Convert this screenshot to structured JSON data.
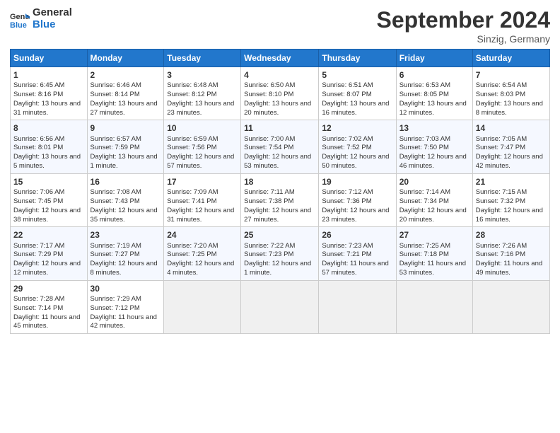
{
  "header": {
    "logo_line1": "General",
    "logo_line2": "Blue",
    "month": "September 2024",
    "location": "Sinzig, Germany"
  },
  "days_of_week": [
    "Sunday",
    "Monday",
    "Tuesday",
    "Wednesday",
    "Thursday",
    "Friday",
    "Saturday"
  ],
  "weeks": [
    [
      {
        "day": "1",
        "sunrise": "6:45 AM",
        "sunset": "8:16 PM",
        "daylight": "13 hours and 31 minutes."
      },
      {
        "day": "2",
        "sunrise": "6:46 AM",
        "sunset": "8:14 PM",
        "daylight": "13 hours and 27 minutes."
      },
      {
        "day": "3",
        "sunrise": "6:48 AM",
        "sunset": "8:12 PM",
        "daylight": "13 hours and 23 minutes."
      },
      {
        "day": "4",
        "sunrise": "6:50 AM",
        "sunset": "8:10 PM",
        "daylight": "13 hours and 20 minutes."
      },
      {
        "day": "5",
        "sunrise": "6:51 AM",
        "sunset": "8:07 PM",
        "daylight": "13 hours and 16 minutes."
      },
      {
        "day": "6",
        "sunrise": "6:53 AM",
        "sunset": "8:05 PM",
        "daylight": "13 hours and 12 minutes."
      },
      {
        "day": "7",
        "sunrise": "6:54 AM",
        "sunset": "8:03 PM",
        "daylight": "13 hours and 8 minutes."
      }
    ],
    [
      {
        "day": "8",
        "sunrise": "6:56 AM",
        "sunset": "8:01 PM",
        "daylight": "13 hours and 5 minutes."
      },
      {
        "day": "9",
        "sunrise": "6:57 AM",
        "sunset": "7:59 PM",
        "daylight": "13 hours and 1 minute."
      },
      {
        "day": "10",
        "sunrise": "6:59 AM",
        "sunset": "7:56 PM",
        "daylight": "12 hours and 57 minutes."
      },
      {
        "day": "11",
        "sunrise": "7:00 AM",
        "sunset": "7:54 PM",
        "daylight": "12 hours and 53 minutes."
      },
      {
        "day": "12",
        "sunrise": "7:02 AM",
        "sunset": "7:52 PM",
        "daylight": "12 hours and 50 minutes."
      },
      {
        "day": "13",
        "sunrise": "7:03 AM",
        "sunset": "7:50 PM",
        "daylight": "12 hours and 46 minutes."
      },
      {
        "day": "14",
        "sunrise": "7:05 AM",
        "sunset": "7:47 PM",
        "daylight": "12 hours and 42 minutes."
      }
    ],
    [
      {
        "day": "15",
        "sunrise": "7:06 AM",
        "sunset": "7:45 PM",
        "daylight": "12 hours and 38 minutes."
      },
      {
        "day": "16",
        "sunrise": "7:08 AM",
        "sunset": "7:43 PM",
        "daylight": "12 hours and 35 minutes."
      },
      {
        "day": "17",
        "sunrise": "7:09 AM",
        "sunset": "7:41 PM",
        "daylight": "12 hours and 31 minutes."
      },
      {
        "day": "18",
        "sunrise": "7:11 AM",
        "sunset": "7:38 PM",
        "daylight": "12 hours and 27 minutes."
      },
      {
        "day": "19",
        "sunrise": "7:12 AM",
        "sunset": "7:36 PM",
        "daylight": "12 hours and 23 minutes."
      },
      {
        "day": "20",
        "sunrise": "7:14 AM",
        "sunset": "7:34 PM",
        "daylight": "12 hours and 20 minutes."
      },
      {
        "day": "21",
        "sunrise": "7:15 AM",
        "sunset": "7:32 PM",
        "daylight": "12 hours and 16 minutes."
      }
    ],
    [
      {
        "day": "22",
        "sunrise": "7:17 AM",
        "sunset": "7:29 PM",
        "daylight": "12 hours and 12 minutes."
      },
      {
        "day": "23",
        "sunrise": "7:19 AM",
        "sunset": "7:27 PM",
        "daylight": "12 hours and 8 minutes."
      },
      {
        "day": "24",
        "sunrise": "7:20 AM",
        "sunset": "7:25 PM",
        "daylight": "12 hours and 4 minutes."
      },
      {
        "day": "25",
        "sunrise": "7:22 AM",
        "sunset": "7:23 PM",
        "daylight": "12 hours and 1 minute."
      },
      {
        "day": "26",
        "sunrise": "7:23 AM",
        "sunset": "7:21 PM",
        "daylight": "11 hours and 57 minutes."
      },
      {
        "day": "27",
        "sunrise": "7:25 AM",
        "sunset": "7:18 PM",
        "daylight": "11 hours and 53 minutes."
      },
      {
        "day": "28",
        "sunrise": "7:26 AM",
        "sunset": "7:16 PM",
        "daylight": "11 hours and 49 minutes."
      }
    ],
    [
      {
        "day": "29",
        "sunrise": "7:28 AM",
        "sunset": "7:14 PM",
        "daylight": "11 hours and 45 minutes."
      },
      {
        "day": "30",
        "sunrise": "7:29 AM",
        "sunset": "7:12 PM",
        "daylight": "11 hours and 42 minutes."
      },
      null,
      null,
      null,
      null,
      null
    ]
  ]
}
